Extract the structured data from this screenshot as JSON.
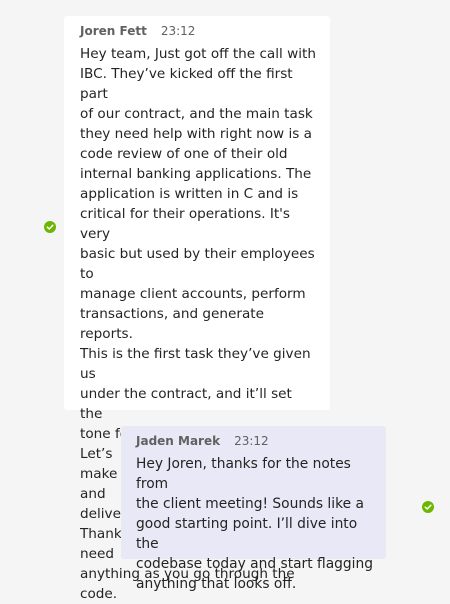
{
  "messages": [
    {
      "sender": "Joren Fett",
      "time": "23:12",
      "body": "Hey team, Just got off the call with\nIBC. They’ve kicked off the first part\nof our contract, and the main task\nthey need help with right now is a\ncode review of one of their old\ninternal banking applications. The\napplication is written in C and is\ncritical for their operations. It's very\nbasic but used by their employees to\nmanage client accounts, perform\ntransactions, and generate reports.\nThis is the first task they’ve given us\nunder the contract, and it’ll set the\ntone for the rest of the project. Let’s\nmake sure we catch everything and\ndeliver a solid first impression.\nThanks, and let me know if you need\nanything as you go through the code.",
      "status_icon": "checkmark-circle-icon",
      "status_color": "#6bb700"
    },
    {
      "sender": "Jaden Marek",
      "time": "23:12",
      "body": "Hey Joren, thanks for the notes from\nthe client meeting! Sounds like a\ngood starting point. I’ll dive into the\ncodebase today and start flagging\nanything that looks off.",
      "status_icon": "checkmark-circle-icon",
      "status_color": "#6bb700"
    }
  ]
}
